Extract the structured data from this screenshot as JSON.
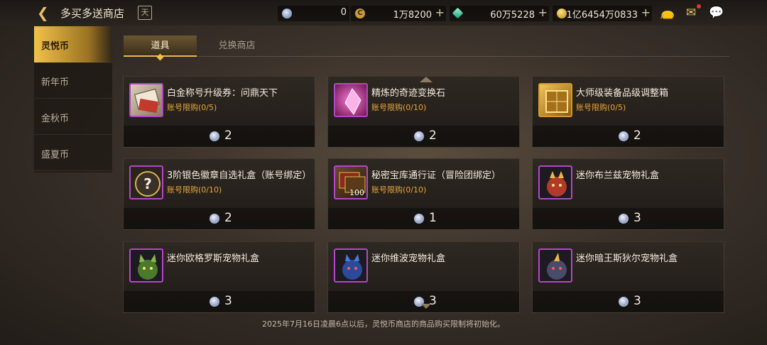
{
  "header": {
    "title": "多买多送商店",
    "calendar_glyph": "天",
    "currencies": [
      {
        "name": "lingyue-coin",
        "value": "0"
      },
      {
        "name": "c-coin",
        "value": "1万8200"
      },
      {
        "name": "green-gem",
        "value": "60万5228"
      },
      {
        "name": "gold-coin",
        "value": "1亿6454万0833"
      }
    ]
  },
  "sidebar": {
    "items": [
      {
        "label": "灵悦币"
      },
      {
        "label": "新年币"
      },
      {
        "label": "金秋币"
      },
      {
        "label": "盛夏币"
      }
    ]
  },
  "tabs": [
    {
      "label": "道具"
    },
    {
      "label": "兑换商店"
    }
  ],
  "items": [
    {
      "name": "白金称号升级券：问鼎天下",
      "limit": "账号限购(0/5)",
      "price": "2",
      "icon": "ticket-icon"
    },
    {
      "name": "精炼的奇迹变换石",
      "limit": "账号限购(0/10)",
      "price": "2",
      "icon": "pink-crystal-icon"
    },
    {
      "name": "大师级装备品级调整箱",
      "limit": "账号限购(0/5)",
      "price": "2",
      "icon": "golden-box-icon"
    },
    {
      "name": "3阶银色徽章自选礼盒（账号绑定）",
      "limit": "账号限购(0/10)",
      "price": "2",
      "icon": "question-box-icon"
    },
    {
      "name": "秘密宝库通行证（冒险团绑定）",
      "limit": "账号限购(0/10)",
      "price": "1",
      "icon": "book-icon",
      "qty": "100"
    },
    {
      "name": "迷你布兰兹宠物礼盒",
      "limit": "",
      "price": "3",
      "icon": "red-pet-icon"
    },
    {
      "name": "迷你欧格罗斯宠物礼盒",
      "limit": "",
      "price": "3",
      "icon": "green-pet-icon"
    },
    {
      "name": "迷你维波宠物礼盒",
      "limit": "",
      "price": "3",
      "icon": "blue-pet-icon"
    },
    {
      "name": "迷你暗王斯狄尔宠物礼盒",
      "limit": "",
      "price": "3",
      "icon": "dark-pet-icon"
    }
  ],
  "footer": {
    "notice": "2025年7月16日凌晨6点以后，灵悦币商店的商品购买限制将初始化。"
  },
  "colors": {
    "accent": "#f3c24a",
    "limit_text": "#e7a73a",
    "rarity_border": "#b645c9"
  }
}
